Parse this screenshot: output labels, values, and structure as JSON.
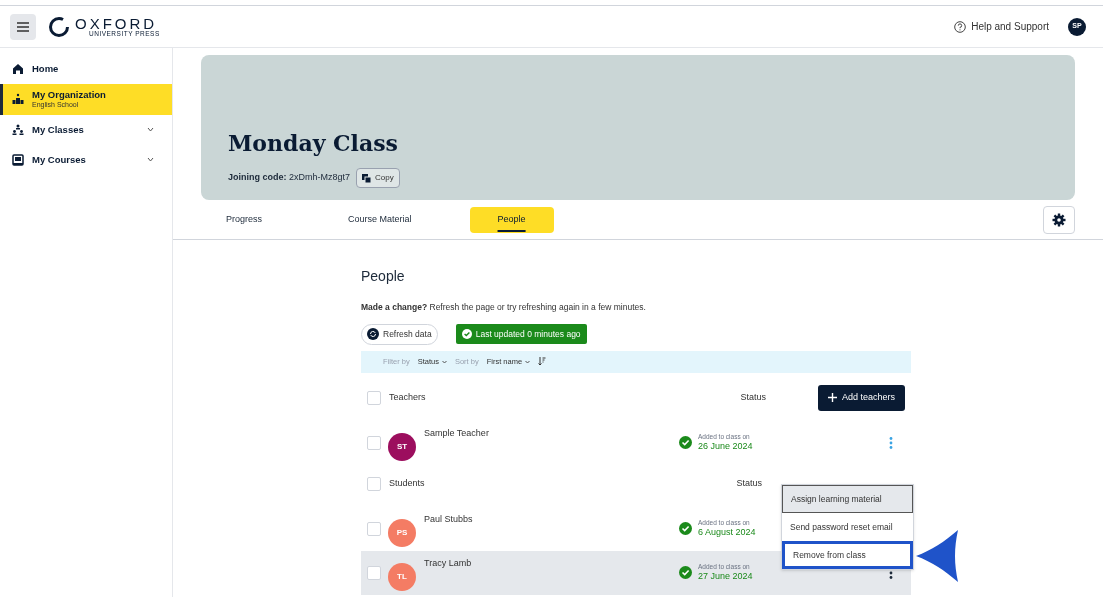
{
  "header": {
    "logo_name": "OXFORD",
    "logo_sub": "UNIVERSITY PRESS",
    "help": "Help and Support",
    "avatar": "SP"
  },
  "sidebar": {
    "items": [
      {
        "kind": "home",
        "label": "Home",
        "selected": false
      },
      {
        "kind": "org",
        "label": "My Organization",
        "subtitle": "English School",
        "selected": true
      },
      {
        "kind": "classes",
        "label": "My Classes",
        "selected": false,
        "expanded": false
      },
      {
        "kind": "courses",
        "label": "My Courses",
        "selected": false,
        "expanded": false
      }
    ]
  },
  "banner": {
    "title": "Monday Class",
    "code_label": "Joining code:",
    "code": "2xDmh-Mz8gt7",
    "copy": "Copy"
  },
  "tabs": [
    {
      "label": "Progress",
      "selected": false
    },
    {
      "label": "Course Material",
      "selected": false
    },
    {
      "label": "People",
      "selected": true
    }
  ],
  "people": {
    "title": "People",
    "note": "**Made a change?** Refresh the page or try refreshing again in a few minutes.",
    "refresh": "Refresh data",
    "last_updated": "Last updated 0 minutes ago",
    "filter": {
      "filter_label": "Filter by",
      "filter_value": "Status",
      "sort_label": "Sort by",
      "sort_value": "First name"
    },
    "groups": [
      {
        "label": "Teachers",
        "status_header": "Status",
        "checked": false,
        "add_button": "Add teachers",
        "rows": [
          {
            "initials": "ST",
            "color": "#9c0e5e",
            "name": "Sample Teacher",
            "status_label": "Added to class on",
            "date": "26 June 2024",
            "checked": false,
            "highlighted": false,
            "menu_open": false,
            "menu_focused": true
          }
        ]
      },
      {
        "label": "Students",
        "status_header": "Status",
        "checked": false,
        "rows": [
          {
            "initials": "PS",
            "color": "#f47c64",
            "name": "Paul Stubbs",
            "status_label": "Added to class on",
            "date": "6 August 2024",
            "checked": false,
            "highlighted": false,
            "menu_open": true
          },
          {
            "initials": "TL",
            "color": "#f47c64",
            "name": "Tracy Lamb",
            "status_label": "Added to class on",
            "date": "27 June 2024",
            "checked": false,
            "highlighted": true,
            "menu_open": false,
            "menu_focused": false
          }
        ]
      }
    ]
  },
  "menu": {
    "items": [
      {
        "label": "Assign learning material",
        "hovered": true,
        "outlined": false
      },
      {
        "label": "Send password reset email",
        "hovered": false,
        "outlined": false
      },
      {
        "label": "Remove from class",
        "hovered": false,
        "outlined": true
      }
    ]
  }
}
